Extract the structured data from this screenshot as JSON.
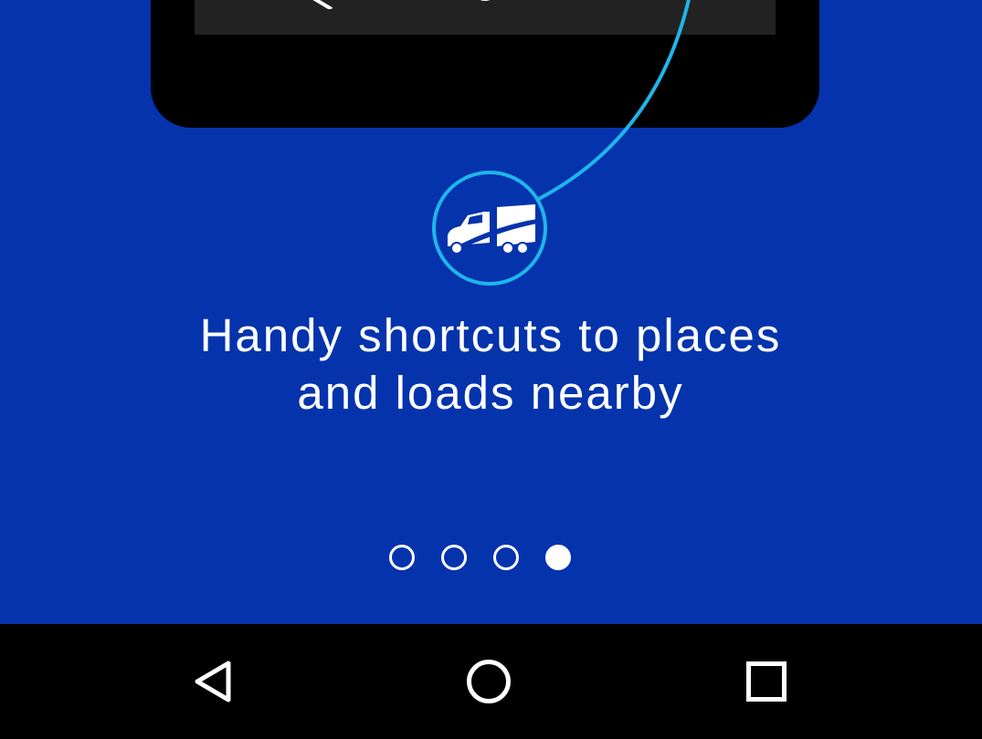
{
  "onboarding": {
    "headline_line1": "Handy shortcuts to places",
    "headline_line2": "and loads nearby",
    "feature_icon": "truck-icon",
    "pager": {
      "total_pages": 4,
      "current_page": 4
    }
  },
  "system_nav": {
    "back_icon": "back-triangle-icon",
    "home_icon": "home-circle-icon",
    "recents_icon": "recents-square-icon"
  },
  "colors": {
    "background": "#0433ac",
    "accent": "#1fb5ea",
    "text": "#ffffff",
    "nav_bar": "#000000"
  }
}
